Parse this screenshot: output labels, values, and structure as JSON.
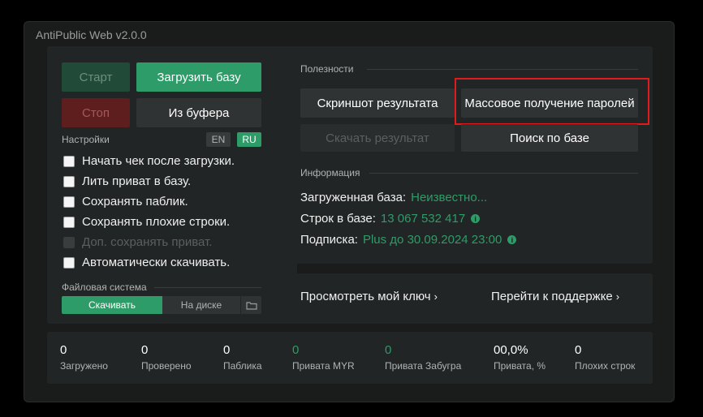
{
  "window": {
    "title": "AntiPublic Web v2.0.0"
  },
  "controls": {
    "start_label": "Старт",
    "load_label": "Загрузить базу",
    "stop_label": "Стоп",
    "clipboard_label": "Из буфера"
  },
  "settings": {
    "label": "Настройки",
    "lang_en": "EN",
    "lang_ru": "RU",
    "options": [
      {
        "label": "Начать чек после загрузки.",
        "enabled": true,
        "checked": false
      },
      {
        "label": "Лить приват в базу.",
        "enabled": true,
        "checked": false
      },
      {
        "label": "Сохранять паблик.",
        "enabled": true,
        "checked": false
      },
      {
        "label": "Сохранять плохие строки.",
        "enabled": true,
        "checked": false
      },
      {
        "label": "Доп. сохранять приват.",
        "enabled": false,
        "checked": false
      },
      {
        "label": "Автоматически скачивать.",
        "enabled": true,
        "checked": false
      }
    ]
  },
  "filesystem": {
    "label": "Файловая система",
    "download_label": "Скачивать",
    "disk_label": "На диске",
    "folder_icon": "folder-icon"
  },
  "utilities": {
    "label": "Полезности",
    "screenshot_label": "Скриншот результата",
    "mass_passwords_label": "Массовое получение паролей",
    "download_result_label": "Скачать результат",
    "search_db_label": "Поиск по базе"
  },
  "info": {
    "label": "Информация",
    "loaded_db_key": "Загруженная база:",
    "loaded_db_value": "Неизвестно...",
    "rows_key": "Строк в базе:",
    "rows_value": "13 067 532 417",
    "subscription_key": "Подписка:",
    "subscription_value": "Plus до 30.09.2024 23:00",
    "info_icon": "info-icon"
  },
  "links": {
    "my_key_label": "Просмотреть мой ключ",
    "support_label": "Перейти к поддержке"
  },
  "stats": [
    {
      "value": "0",
      "label": "Загружено"
    },
    {
      "value": "0",
      "label": "Проверено"
    },
    {
      "value": "0",
      "label": "Паблика"
    },
    {
      "value": "0",
      "label": "Привата MYR"
    },
    {
      "value": "0",
      "label": "Привата Забугра"
    },
    {
      "value": "00,0%",
      "label": "Привата, %"
    },
    {
      "value": "0",
      "label": "Плохих строк"
    }
  ],
  "colors": {
    "accent": "#2e9c68",
    "highlight": "#e01b1b",
    "background": "#1a1c1c"
  }
}
